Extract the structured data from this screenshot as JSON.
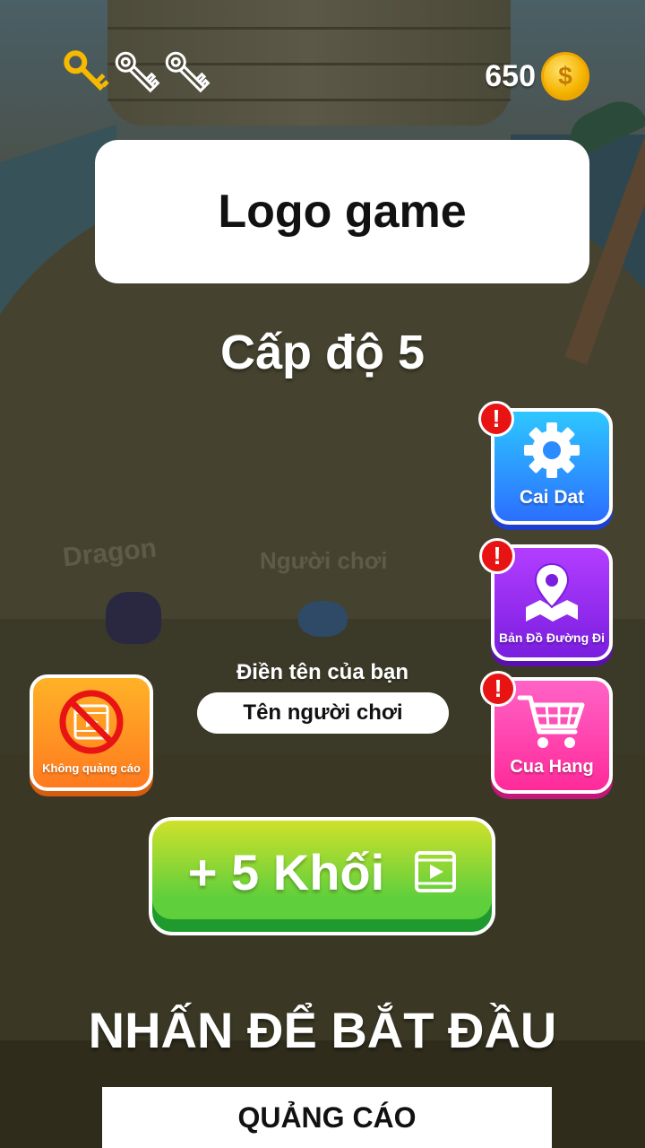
{
  "hud": {
    "keys": [
      {
        "icon": "key-icon",
        "state": "collected",
        "color": "#f7b800"
      },
      {
        "icon": "key-icon",
        "state": "empty",
        "color": "#ffffff"
      },
      {
        "icon": "key-icon",
        "state": "empty",
        "color": "#ffffff"
      }
    ],
    "coins": "650",
    "coin_icon": "dollar-coin-icon"
  },
  "logo": {
    "text": "Logo game"
  },
  "level": {
    "text": "Cấp độ 5"
  },
  "side_buttons": {
    "settings": {
      "label": "Cai Dat",
      "icon": "gear-icon",
      "alert": "!"
    },
    "map": {
      "label": "Bản Đồ Đường Đi",
      "icon": "map-pin-icon",
      "alert": "!"
    },
    "shop": {
      "label": "Cua Hang",
      "icon": "shopping-cart-icon",
      "alert": "!"
    },
    "no_ads": {
      "label": "Không quảng cáo",
      "icon": "no-video-ad-icon"
    }
  },
  "scene": {
    "player_name_left": "Dragon",
    "player_name_right": "Người chơi"
  },
  "name_entry": {
    "label": "Điền tên của bạn",
    "value": "Tên người chơi"
  },
  "reward_button": {
    "label": "+ 5 Khối",
    "icon": "video-play-icon"
  },
  "start_text": "NHẤN ĐỂ BẮT ĐẦU",
  "ad_banner": {
    "text": "QUẢNG CÁO"
  },
  "colors": {
    "settings": "#2b8cff",
    "map": "#8a25ea",
    "shop": "#ff3aa8",
    "no_ads": "#ff9520",
    "reward": "#5fcf3c"
  }
}
